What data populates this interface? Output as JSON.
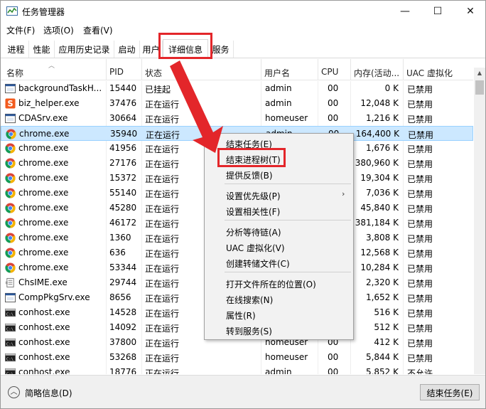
{
  "window": {
    "title": "任务管理器",
    "minimize": "—",
    "maximize": "☐",
    "close": "✕"
  },
  "menu": [
    "文件(F)",
    "选项(O)",
    "查看(V)"
  ],
  "tabs": [
    "进程",
    "性能",
    "应用历史记录",
    "启动",
    "用户",
    "详细信息",
    "服务"
  ],
  "active_tab": "详细信息",
  "columns": [
    "名称",
    "PID",
    "状态",
    "用户名",
    "CPU",
    "内存(活动...",
    "UAC 虚拟化"
  ],
  "rows": [
    {
      "icon": "app-icon",
      "name": "backgroundTaskH...",
      "pid": "15440",
      "status": "已挂起",
      "user": "admin",
      "cpu": "00",
      "mem": "0 K",
      "uac": "已禁用"
    },
    {
      "icon": "s-app-icon",
      "name": "biz_helper.exe",
      "pid": "37476",
      "status": "正在运行",
      "user": "admin",
      "cpu": "00",
      "mem": "12,048 K",
      "uac": "已禁用"
    },
    {
      "icon": "app-icon",
      "name": "CDASrv.exe",
      "pid": "30664",
      "status": "正在运行",
      "user": "homeuser",
      "cpu": "00",
      "mem": "1,216 K",
      "uac": "已禁用"
    },
    {
      "icon": "chrome-icon",
      "name": "chrome.exe",
      "pid": "35940",
      "status": "正在运行",
      "user": "admin",
      "cpu": "00",
      "mem": "164,400 K",
      "uac": "已禁用"
    },
    {
      "icon": "chrome-icon",
      "name": "chrome.exe",
      "pid": "41956",
      "status": "正在运行",
      "user": "",
      "cpu": "",
      "mem": "1,676 K",
      "uac": "已禁用"
    },
    {
      "icon": "chrome-icon",
      "name": "chrome.exe",
      "pid": "27176",
      "status": "正在运行",
      "user": "",
      "cpu": "",
      "mem": "380,960 K",
      "uac": "已禁用"
    },
    {
      "icon": "chrome-icon",
      "name": "chrome.exe",
      "pid": "15372",
      "status": "正在运行",
      "user": "",
      "cpu": "",
      "mem": "19,304 K",
      "uac": "已禁用"
    },
    {
      "icon": "chrome-icon",
      "name": "chrome.exe",
      "pid": "55140",
      "status": "正在运行",
      "user": "",
      "cpu": "",
      "mem": "7,036 K",
      "uac": "已禁用"
    },
    {
      "icon": "chrome-icon",
      "name": "chrome.exe",
      "pid": "45280",
      "status": "正在运行",
      "user": "",
      "cpu": "",
      "mem": "45,840 K",
      "uac": "已禁用"
    },
    {
      "icon": "chrome-icon",
      "name": "chrome.exe",
      "pid": "46172",
      "status": "正在运行",
      "user": "",
      "cpu": "",
      "mem": "381,184 K",
      "uac": "已禁用"
    },
    {
      "icon": "chrome-icon",
      "name": "chrome.exe",
      "pid": "1360",
      "status": "正在运行",
      "user": "",
      "cpu": "",
      "mem": "3,808 K",
      "uac": "已禁用"
    },
    {
      "icon": "chrome-icon",
      "name": "chrome.exe",
      "pid": "636",
      "status": "正在运行",
      "user": "",
      "cpu": "",
      "mem": "12,568 K",
      "uac": "已禁用"
    },
    {
      "icon": "chrome-icon",
      "name": "chrome.exe",
      "pid": "53344",
      "status": "正在运行",
      "user": "",
      "cpu": "",
      "mem": "10,284 K",
      "uac": "已禁用"
    },
    {
      "icon": "ime-icon",
      "name": "ChsIME.exe",
      "pid": "29744",
      "status": "正在运行",
      "user": "",
      "cpu": "",
      "mem": "2,320 K",
      "uac": "已禁用"
    },
    {
      "icon": "app-icon",
      "name": "CompPkgSrv.exe",
      "pid": "8656",
      "status": "正在运行",
      "user": "",
      "cpu": "",
      "mem": "1,652 K",
      "uac": "已禁用"
    },
    {
      "icon": "console-icon",
      "name": "conhost.exe",
      "pid": "14528",
      "status": "正在运行",
      "user": "",
      "cpu": "",
      "mem": "516 K",
      "uac": "已禁用"
    },
    {
      "icon": "console-icon",
      "name": "conhost.exe",
      "pid": "14092",
      "status": "正在运行",
      "user": "",
      "cpu": "",
      "mem": "512 K",
      "uac": "已禁用"
    },
    {
      "icon": "console-icon",
      "name": "conhost.exe",
      "pid": "37800",
      "status": "正在运行",
      "user": "homeuser",
      "cpu": "00",
      "mem": "412 K",
      "uac": "已禁用"
    },
    {
      "icon": "console-icon",
      "name": "conhost.exe",
      "pid": "53268",
      "status": "正在运行",
      "user": "homeuser",
      "cpu": "00",
      "mem": "5,844 K",
      "uac": "已禁用"
    },
    {
      "icon": "console-icon",
      "name": "conhost.exe",
      "pid": "18776",
      "status": "正在运行",
      "user": "admin",
      "cpu": "00",
      "mem": "5,852 K",
      "uac": "不允许"
    }
  ],
  "selected_row": 3,
  "context_menu": [
    [
      "结束任务(E)",
      "结束进程树(T)",
      "提供反馈(B)"
    ],
    [
      "设置优先级(P)",
      "设置相关性(F)"
    ],
    [
      "分析等待链(A)",
      "UAC 虚拟化(V)",
      "创建转储文件(C)"
    ],
    [
      "打开文件所在的位置(O)",
      "在线搜索(N)",
      "属性(R)",
      "转到服务(S)"
    ]
  ],
  "submenu_arrow": "›",
  "footer": {
    "fewer_details": "简略信息(D)",
    "end_task": "结束任务(E)",
    "fewer_icon": "︿"
  },
  "colors": {
    "highlight": "#e3262a",
    "selection": "#cce8ff"
  }
}
